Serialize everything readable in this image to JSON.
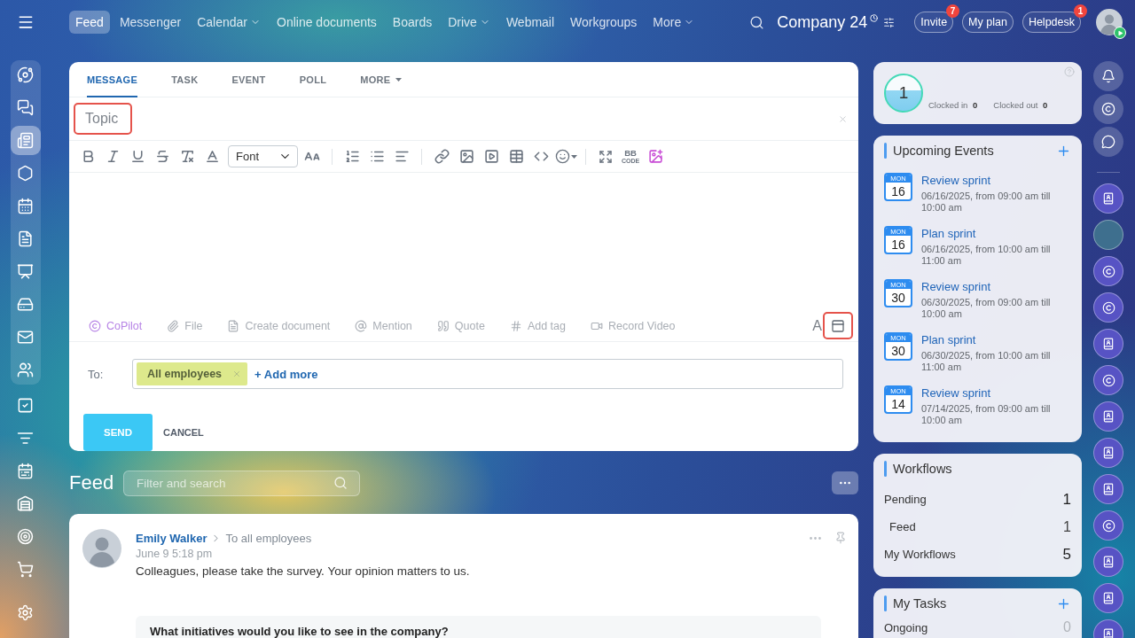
{
  "topbar": {
    "nav": [
      {
        "label": "Feed",
        "selected": true,
        "dropdown": false
      },
      {
        "label": "Messenger",
        "selected": false,
        "dropdown": false
      },
      {
        "label": "Calendar",
        "selected": false,
        "dropdown": true
      },
      {
        "label": "Online documents",
        "selected": false,
        "dropdown": false
      },
      {
        "label": "Boards",
        "selected": false,
        "dropdown": false
      },
      {
        "label": "Drive",
        "selected": false,
        "dropdown": true
      },
      {
        "label": "Webmail",
        "selected": false,
        "dropdown": false
      },
      {
        "label": "Workgroups",
        "selected": false,
        "dropdown": false
      },
      {
        "label": "More",
        "selected": false,
        "dropdown": true
      }
    ],
    "company": "Company 24",
    "buttons": [
      {
        "label": "Invite",
        "badge": "7"
      },
      {
        "label": "My plan"
      },
      {
        "label": "Helpdesk",
        "badge": "1"
      }
    ]
  },
  "sidebar": {
    "panel_items": [
      {
        "selected": false
      },
      {
        "selected": false
      },
      {
        "selected": true
      },
      {
        "selected": false
      },
      {
        "selected": false
      },
      {
        "selected": false
      },
      {
        "selected": false
      },
      {
        "selected": false
      },
      {
        "selected": false
      },
      {
        "selected": false
      }
    ],
    "items": [
      {
        "selected": false
      },
      {
        "selected": false
      },
      {
        "selected": false
      },
      {
        "selected": false
      },
      {
        "selected": false
      },
      {
        "selected": false
      }
    ],
    "settings": {
      "selected": false
    }
  },
  "composer": {
    "tabs": [
      {
        "label": "MESSAGE",
        "selected": true,
        "dropdown": false
      },
      {
        "label": "TASK",
        "selected": false,
        "dropdown": false
      },
      {
        "label": "EVENT",
        "selected": false,
        "dropdown": false
      },
      {
        "label": "POLL",
        "selected": false,
        "dropdown": false
      },
      {
        "label": "MORE",
        "selected": false,
        "dropdown": true
      }
    ],
    "topic": {
      "placeholder": "Topic",
      "highlighted": true
    },
    "toolbar": {
      "font": "Font",
      "bbcode": "BB",
      "bbcode_caption": "CODE"
    },
    "attachments": [
      {
        "kind": "copilot",
        "label": "CoPilot"
      },
      {
        "kind": "file",
        "label": "File"
      },
      {
        "kind": "document",
        "label": "Create document"
      },
      {
        "kind": "mention",
        "label": "Mention"
      },
      {
        "kind": "quote",
        "label": "Quote"
      },
      {
        "kind": "tag",
        "label": "Add tag"
      },
      {
        "kind": "video",
        "label": "Record Video"
      }
    ],
    "format_toggle": "A",
    "panel_toggle": {
      "highlighted": true
    },
    "recipients": {
      "label": "To:",
      "tags": [
        "All employees"
      ],
      "add_more": "+ Add more"
    },
    "send": "SEND",
    "cancel": "CANCEL"
  },
  "feed": {
    "title": "Feed",
    "search": {
      "placeholder": "Filter and search"
    },
    "posts": [
      {
        "author": "Emily Walker",
        "audience": "To all employees",
        "time": "June 9 5:18 pm",
        "text": "Colleagues, please take the survey. Your opinion matters to us.",
        "survey": {
          "question": "What initiatives would you like to see in the company?"
        }
      }
    ]
  },
  "worktime": {
    "count": "1",
    "clocked_in": {
      "label": "Clocked in",
      "value": "0"
    },
    "clocked_out": {
      "label": "Clocked out",
      "value": "0"
    }
  },
  "events": {
    "title": "Upcoming Events",
    "items": [
      {
        "weekday": "MON",
        "day": "16",
        "title": "Review sprint",
        "time": "06/16/2025, from 09:00 am till 10:00 am"
      },
      {
        "weekday": "MON",
        "day": "16",
        "title": "Plan sprint",
        "time": "06/16/2025, from 10:00 am till 11:00 am"
      },
      {
        "weekday": "MON",
        "day": "30",
        "title": "Review sprint",
        "time": "06/30/2025, from 09:00 am till 10:00 am"
      },
      {
        "weekday": "MON",
        "day": "30",
        "title": "Plan sprint",
        "time": "06/30/2025, from 10:00 am till 11:00 am"
      },
      {
        "weekday": "MON",
        "day": "14",
        "title": "Review sprint",
        "time": "07/14/2025, from 09:00 am till 10:00 am"
      }
    ]
  },
  "workflows": {
    "title": "Workflows",
    "rows": [
      {
        "label": "Pending",
        "value": "1",
        "children": [
          {
            "label": "Feed",
            "value": "1"
          }
        ]
      },
      {
        "label": "My Workflows",
        "value": "5"
      }
    ]
  },
  "tasks": {
    "title": "My Tasks",
    "rows": [
      {
        "label": "Ongoing",
        "value": "0"
      }
    ]
  }
}
